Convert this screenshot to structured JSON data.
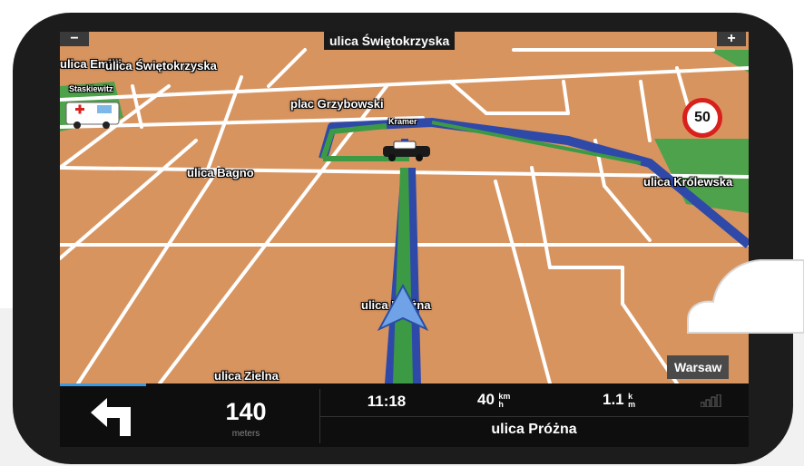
{
  "top_bar": {
    "street": "ulica Świętokrzyska",
    "zoom_out": "−",
    "zoom_in": "+"
  },
  "map_labels": {
    "street_1": "ulica Emilii",
    "street_2": "ulica Świętokrzyska",
    "street_3": "Staskiewitz",
    "square": "plac Grzybowski",
    "poi": "Kramer",
    "street_4": "ulica Bagno",
    "street_5": "ulica Królewska",
    "street_6": "ulica Próżna",
    "street_7": "ulica Zielna"
  },
  "speed_limit": "50",
  "city": "Warsaw",
  "bottom_bar": {
    "distance_value": "140",
    "distance_unit": "meters",
    "time": "11:18",
    "speed_value": "40",
    "speed_unit_top": "km",
    "speed_unit_bottom": "h",
    "remaining_value": "1.1",
    "remaining_unit_top": "k",
    "remaining_unit_bottom": "m",
    "current_street": "ulica Próżna"
  },
  "colors": {
    "map": "#d8945f",
    "route": "#2f49a8",
    "green": "#3c9a45",
    "device": "#1c1c1c"
  }
}
